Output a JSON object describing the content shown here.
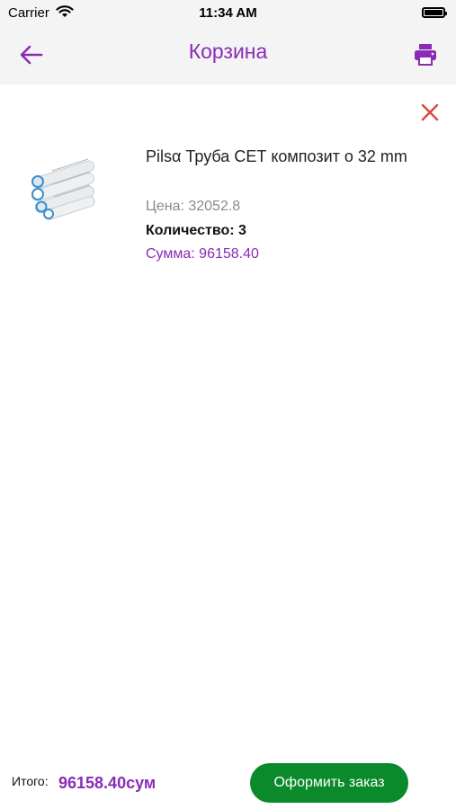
{
  "status_bar": {
    "carrier": "Carrier",
    "time": "11:34 AM"
  },
  "nav": {
    "title": "Корзина",
    "back_icon": "arrow-left-icon",
    "print_icon": "printer-icon"
  },
  "cart": {
    "items": [
      {
        "name": "Pilsα Труба СЕТ композит о 32 mm",
        "price_text": "Цена: 32052.8",
        "quantity_text": "Количество: 3",
        "sum_text": "Сумма: 96158.40"
      }
    ]
  },
  "footer": {
    "total_label": "Итого:",
    "total_value": "96158.40сум",
    "order_button": "Оформить заказ"
  },
  "colors": {
    "accent": "#8a2bb5",
    "remove": "#e0443a",
    "order_button": "#0a8a2a",
    "bar_background": "#f4f4f4"
  }
}
